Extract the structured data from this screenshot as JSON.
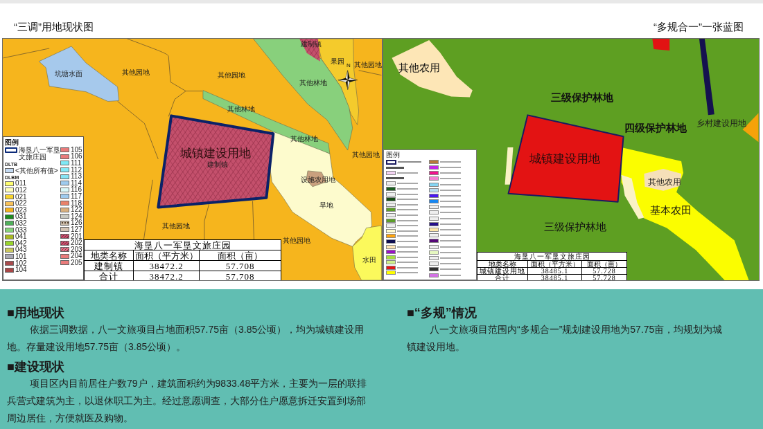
{
  "titles": {
    "left": "“三调”用地现状图",
    "right": "“多规合一”一张蓝图"
  },
  "survey_map": {
    "compass": {
      "label": "N"
    },
    "labels": [
      {
        "text": "坑塘水面",
        "kind": "small"
      },
      {
        "text": "其他园地",
        "kind": "small"
      },
      {
        "text": "其他园地",
        "kind": "small"
      },
      {
        "text": "建制镇",
        "kind": "small"
      },
      {
        "text": "果园",
        "kind": "small"
      },
      {
        "text": "其他园地",
        "kind": "small"
      },
      {
        "text": "其他林地",
        "kind": "small"
      },
      {
        "text": "其他林地",
        "kind": "small"
      },
      {
        "text": "城镇建设用地",
        "kind": "large"
      },
      {
        "text": "建制镇",
        "kind": "small"
      },
      {
        "text": "其他林地",
        "kind": "small"
      },
      {
        "text": "其他园地",
        "kind": "small"
      },
      {
        "text": "设施农用地",
        "kind": "small"
      },
      {
        "text": "旱地",
        "kind": "small"
      },
      {
        "text": "其他园地",
        "kind": "small"
      },
      {
        "text": "其他园地",
        "kind": "small"
      },
      {
        "text": "水田",
        "kind": "small"
      }
    ],
    "legend": {
      "title": "图例",
      "columns": [
        [
          {
            "kind": "outline",
            "color": "#0b2a78",
            "label": "海垦八一军垦文旅庄园"
          },
          {
            "kind": "heading",
            "label": "DLTB"
          },
          {
            "kind": "swatch",
            "color": "#c4daf2",
            "label": "<其他所有值>"
          },
          {
            "kind": "heading",
            "label": "DLBM"
          },
          {
            "kind": "swatch",
            "color": "#fdfd6e",
            "label": "011"
          },
          {
            "kind": "swatch",
            "color": "#fefeb8",
            "label": "012"
          },
          {
            "kind": "swatch",
            "color": "#f6d32e",
            "label": "021"
          },
          {
            "kind": "swatch",
            "color": "#f8c25a",
            "label": "022"
          },
          {
            "kind": "swatch",
            "color": "#f6b21c",
            "label": "023"
          },
          {
            "kind": "swatch",
            "color": "#1f8a1f",
            "label": "031"
          },
          {
            "kind": "swatch",
            "color": "#4faf5a",
            "label": "032"
          },
          {
            "kind": "swatch",
            "color": "#86d27a",
            "label": "033"
          },
          {
            "kind": "swatch",
            "color": "#a9b823",
            "label": "041"
          },
          {
            "kind": "swatch",
            "color": "#98d42c",
            "label": "042"
          },
          {
            "kind": "swatch",
            "color": "#c9c65e",
            "label": "043"
          },
          {
            "kind": "swatch",
            "color": "#a9a9b4",
            "label": "101"
          },
          {
            "kind": "swatch",
            "color": "#a84a4c",
            "label": "102"
          },
          {
            "kind": "swatch",
            "color": "#a84646",
            "label": "104"
          }
        ],
        [
          {
            "kind": "swatch",
            "color": "#e97b7b",
            "label": "105"
          },
          {
            "kind": "swatch",
            "color": "#e97b7b",
            "label": "106"
          },
          {
            "kind": "swatch",
            "color": "#80e9f6",
            "label": "111"
          },
          {
            "kind": "swatch",
            "color": "#86eaf6",
            "label": "112"
          },
          {
            "kind": "swatch",
            "color": "#86e4f4",
            "label": "113"
          },
          {
            "kind": "swatch",
            "color": "#9fcbee",
            "label": "114"
          },
          {
            "kind": "swatch",
            "color": "#d9f8f8",
            "label": "116"
          },
          {
            "kind": "swatch",
            "color": "#9fcbee",
            "label": "117"
          },
          {
            "kind": "swatch",
            "color": "#e9826a",
            "label": "118"
          },
          {
            "kind": "swatch",
            "color": "#d9b07e",
            "label": "122"
          },
          {
            "kind": "swatch",
            "color": "#c9c9c1",
            "label": "124"
          },
          {
            "kind": "dotted",
            "color": "#c9bba9",
            "label": "126"
          },
          {
            "kind": "swatch",
            "color": "#d3c3b3",
            "label": "127"
          },
          {
            "kind": "hatched",
            "color": "#c4506c",
            "label": "201"
          },
          {
            "kind": "hatched",
            "color": "#c4506c",
            "label": "202"
          },
          {
            "kind": "hatched",
            "color": "#e07488",
            "label": "203"
          },
          {
            "kind": "swatch",
            "color": "#e97b7b",
            "label": "204"
          },
          {
            "kind": "swatch",
            "color": "#e97b7b",
            "label": "205"
          }
        ]
      ]
    },
    "table": {
      "title": "海垦八一军垦文旅庄园",
      "columns": [
        "地类名称",
        "面积（平方米）",
        "面积（亩）"
      ],
      "rows": [
        [
          "建制镇",
          "38472.2",
          "57.708"
        ],
        [
          "合计",
          "38472.2",
          "57.708"
        ]
      ]
    }
  },
  "plan_map": {
    "labels": [
      {
        "text": "其他农用",
        "kind": "medium"
      },
      {
        "text": "三级保护林地",
        "kind": "bold"
      },
      {
        "text": "四级保护林地",
        "kind": "bold"
      },
      {
        "text": "乡村建设用地",
        "kind": "normal"
      },
      {
        "text": "城镇建设用地",
        "kind": "large"
      },
      {
        "text": "其他农用",
        "kind": "normal"
      },
      {
        "text": "基本农田",
        "kind": "medium"
      },
      {
        "text": "三级保护林地",
        "kind": "medium"
      }
    ],
    "legend": {
      "title": "图例",
      "columns": [
        [
          {
            "kind": "outline",
            "color": "#1a1a60"
          },
          {
            "kind": "heading"
          },
          {
            "kind": "swatch",
            "color": "#f2d2f2"
          },
          {
            "kind": "heading"
          },
          {
            "kind": "swatch",
            "color": "#eeeeee"
          },
          {
            "kind": "swatch",
            "color": "#1b5e20"
          },
          {
            "kind": "swatch",
            "color": "#eeeeee"
          },
          {
            "kind": "swatch",
            "color": "#174d17"
          },
          {
            "kind": "swatch",
            "color": "#eeeeee"
          },
          {
            "kind": "swatch",
            "color": "#5d9f2a"
          },
          {
            "kind": "swatch",
            "color": "#eeeeee"
          },
          {
            "kind": "swatch",
            "color": "#5d9f2a"
          },
          {
            "kind": "swatch",
            "color": "#eeeeee"
          },
          {
            "kind": "swatch",
            "color": "#fffbd0"
          },
          {
            "kind": "swatch",
            "color": "#ffa510"
          },
          {
            "kind": "swatch",
            "color": "#0e0e50"
          },
          {
            "kind": "swatch",
            "color": "#fde3b4"
          },
          {
            "kind": "swatch",
            "color": "#9a12c8"
          },
          {
            "kind": "swatch",
            "color": "#a6e040"
          },
          {
            "kind": "swatch",
            "color": "#d0f08a"
          },
          {
            "kind": "swatch",
            "color": "#e31414"
          },
          {
            "kind": "swatch",
            "color": "#ffff00"
          }
        ],
        [
          {
            "kind": "swatch",
            "color": "#b8783a"
          },
          {
            "kind": "swatch",
            "color": "#c424e8"
          },
          {
            "kind": "swatch",
            "color": "#f0128c"
          },
          {
            "kind": "swatch",
            "color": "#f580d2"
          },
          {
            "kind": "swatch",
            "color": "#86d6f4"
          },
          {
            "kind": "swatch",
            "color": "#b8dcf2"
          },
          {
            "kind": "swatch",
            "color": "#4a16f2"
          },
          {
            "kind": "swatch",
            "color": "#1686f2"
          },
          {
            "kind": "swatch",
            "color": "#eeeeee"
          },
          {
            "kind": "swatch",
            "color": "#eeeeee"
          },
          {
            "kind": "swatch",
            "color": "#eeeeee"
          },
          {
            "kind": "swatch",
            "color": "#24108a"
          },
          {
            "kind": "swatch",
            "color": "#fde6a8"
          },
          {
            "kind": "swatch",
            "color": "#eeeeee"
          },
          {
            "kind": "swatch",
            "color": "#560878"
          },
          {
            "kind": "swatch",
            "color": "#eeeeee"
          },
          {
            "kind": "swatch",
            "color": "#e6f8c0"
          },
          {
            "kind": "swatch",
            "color": "#eeeeee"
          },
          {
            "kind": "swatch",
            "color": "#eeeeee"
          },
          {
            "kind": "swatch",
            "color": "#2e2e2e"
          },
          {
            "kind": "swatch",
            "color": "#d472e6"
          }
        ]
      ]
    },
    "table": {
      "title": "海垦八一军垦文旅庄园",
      "columns": [
        "地类名称",
        "面积（平方米）",
        "面积（亩）"
      ],
      "rows": [
        [
          "城镇建设用地",
          "38485.1",
          "57.728"
        ],
        [
          "合计",
          "38485.1",
          "57.728"
        ]
      ]
    }
  },
  "sections": {
    "left": [
      {
        "heading": "■用地现状",
        "text": "依据三调数据，八一文旅项目占地面积57.75亩（3.85公顷），均为城镇建设用地。存量建设用地57.75亩（3.85公顷）。"
      },
      {
        "heading": "■建设现状",
        "text": "项目区内目前居住户数79户，建筑面积约为9833.48平方米，主要为一层的联排兵营式建筑为主，以退休职工为主。经过意愿调查，大部分住户愿意拆迁安置到场部周边居住，方便就医及购物。"
      }
    ],
    "right": [
      {
        "heading": "■“多规”情况",
        "text": "八一文旅项目范围内“多规合一”规划建设用地为57.75亩，均规划为城镇建设用地。"
      }
    ]
  }
}
